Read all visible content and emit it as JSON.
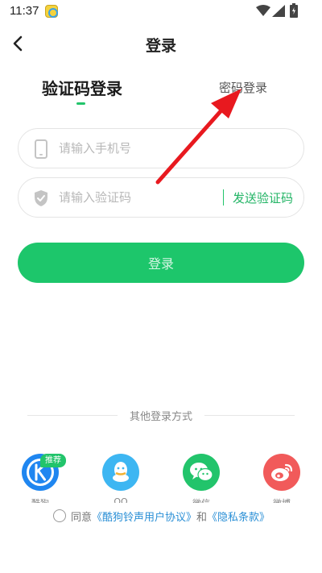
{
  "status_bar": {
    "time": "11:37"
  },
  "header": {
    "title": "登录"
  },
  "tabs": {
    "sms_label": "验证码登录",
    "password_label": "密码登录"
  },
  "phone_field": {
    "placeholder": "请输入手机号",
    "value": ""
  },
  "code_field": {
    "placeholder": "请输入验证码",
    "value": "",
    "send_label": "发送验证码"
  },
  "login_button": {
    "label": "登录"
  },
  "other_login": {
    "title": "其他登录方式",
    "recommend_badge": "推荐",
    "providers": [
      {
        "name": "kugou",
        "icon": "kugou-icon",
        "label": "酷狗"
      },
      {
        "name": "qq",
        "icon": "qq-icon",
        "label": "QQ"
      },
      {
        "name": "wechat",
        "icon": "wechat-icon",
        "label": "微信"
      },
      {
        "name": "weibo",
        "icon": "weibo-icon",
        "label": "微博"
      }
    ]
  },
  "agreement": {
    "prefix": "同意",
    "user_agreement": "《酷狗铃声用户协议》",
    "conjunction": "和",
    "privacy_policy": "《隐私条款》"
  },
  "colors": {
    "accent": "#1dc66b",
    "link": "#2a8fd6",
    "annotation": "#e8191f"
  }
}
